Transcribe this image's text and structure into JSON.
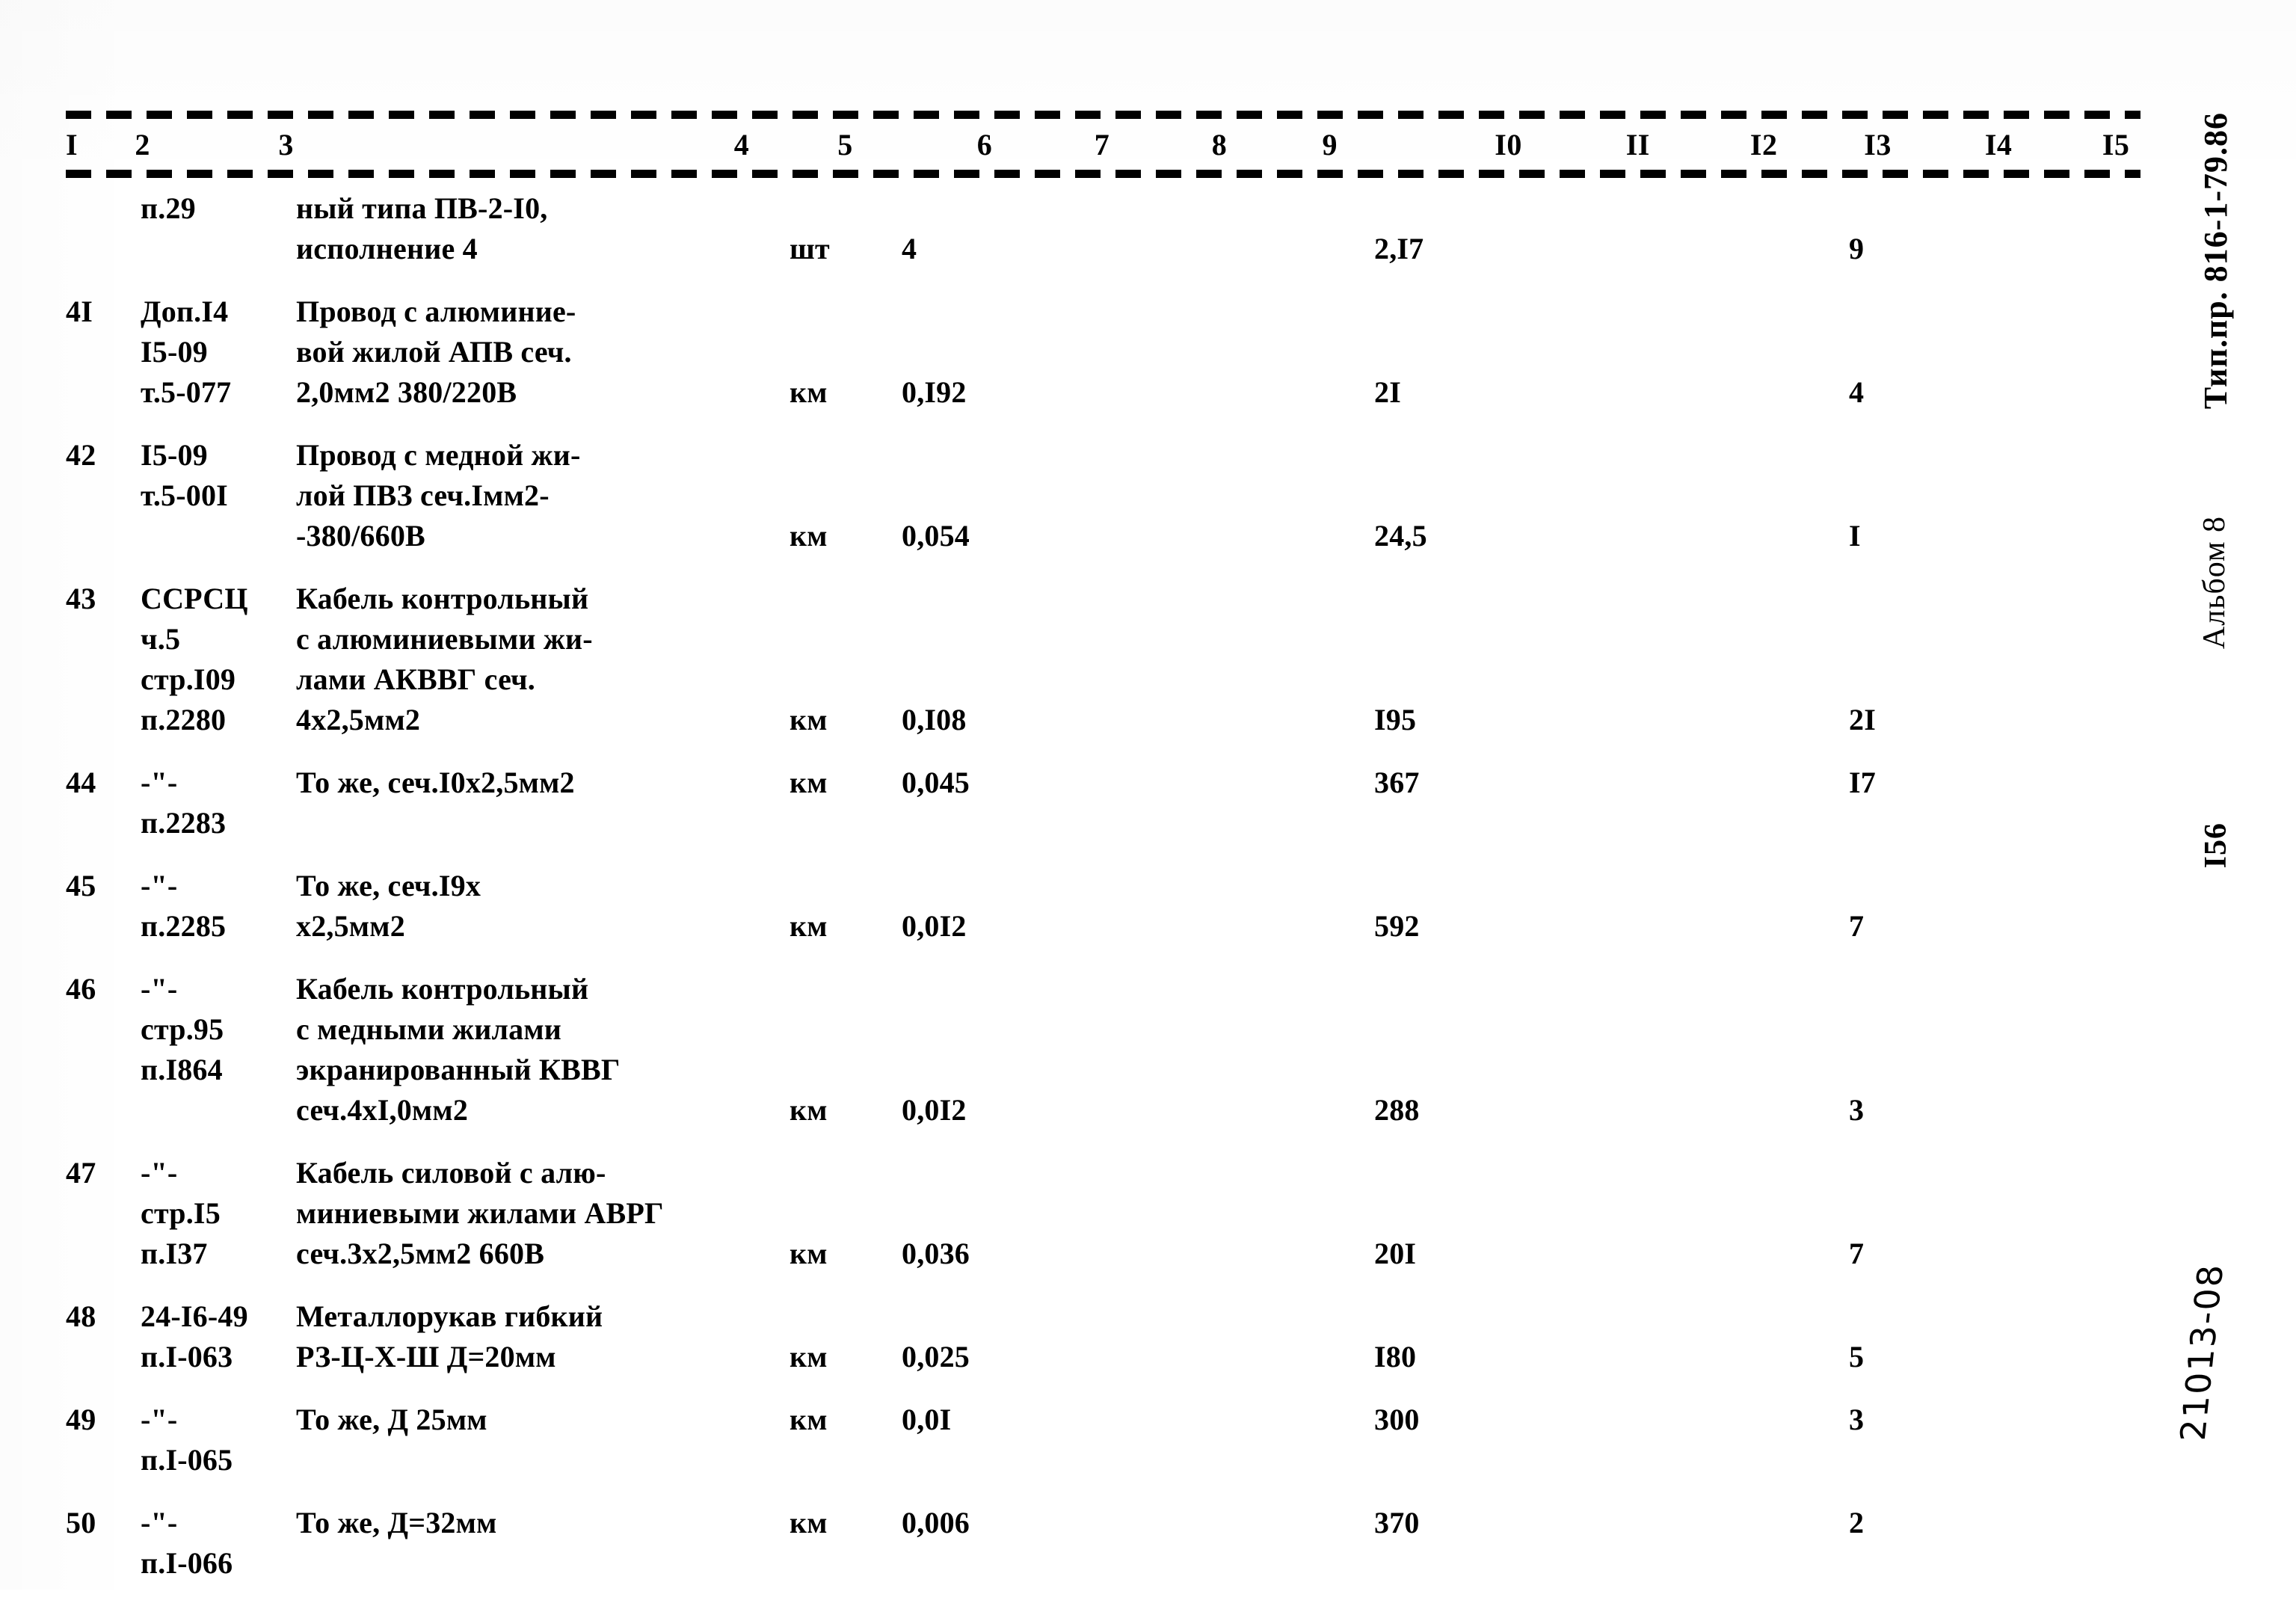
{
  "document": {
    "stamp_title": "Тип.пр. 816-1-79.86",
    "stamp_album": "Альбом 8",
    "stamp_page": "I56",
    "handwritten_mark": "21013-08"
  },
  "table": {
    "column_headers": [
      "I",
      "2",
      "3",
      "4",
      "5",
      "6",
      "7",
      "8",
      "9",
      "I0",
      "II",
      "I2",
      "I3",
      "I4",
      "I5"
    ],
    "rows": [
      {
        "num": "",
        "code": [
          "п.29"
        ],
        "name": [
          "ный типа ПВ-2-I0,",
          "исполнение 4"
        ],
        "unit": "шт",
        "qty": "4",
        "c9": "2,I7",
        "c13": "9",
        "unit_line": 1,
        "qty_line": 1,
        "c9_line": 1,
        "c13_line": 1
      },
      {
        "num": "4I",
        "code": [
          "Доп.I4",
          "I5-09",
          "т.5-077"
        ],
        "name": [
          "Провод с алюминие-",
          "вой жилой АПВ сеч.",
          "2,0мм2 380/220В"
        ],
        "unit": "км",
        "qty": "0,I92",
        "c9": "2I",
        "c13": "4",
        "unit_line": 2,
        "qty_line": 2,
        "c9_line": 2,
        "c13_line": 2
      },
      {
        "num": "42",
        "code": [
          "I5-09",
          "т.5-00I"
        ],
        "name": [
          "Провод с медной жи-",
          "лой ПВЗ сеч.Iмм2-",
          "-380/660В"
        ],
        "unit": "км",
        "qty": "0,054",
        "c9": "24,5",
        "c13": "I",
        "unit_line": 2,
        "qty_line": 2,
        "c9_line": 2,
        "c13_line": 2
      },
      {
        "num": "43",
        "code": [
          "ССРСЦ",
          "ч.5",
          "стр.I09",
          "п.2280"
        ],
        "name": [
          "Кабель контрольный",
          "с алюминиевыми жи-",
          "лами АКВВГ сеч.",
          "4х2,5мм2"
        ],
        "unit": "км",
        "qty": "0,I08",
        "c9": "I95",
        "c13": "2I",
        "unit_line": 3,
        "qty_line": 3,
        "c9_line": 3,
        "c13_line": 3
      },
      {
        "num": "44",
        "code": [
          "-\"-",
          "п.2283"
        ],
        "name": [
          "То же, сеч.I0х2,5мм2"
        ],
        "unit": "км",
        "qty": "0,045",
        "c9": "367",
        "c13": "I7",
        "unit_line": 0,
        "qty_line": 0,
        "c9_line": 0,
        "c13_line": 0
      },
      {
        "num": "45",
        "code": [
          "-\"-",
          "п.2285"
        ],
        "name": [
          "То же, сеч.I9х",
          "х2,5мм2"
        ],
        "unit": "км",
        "qty": "0,0I2",
        "c9": "592",
        "c13": "7",
        "unit_line": 1,
        "qty_line": 1,
        "c9_line": 1,
        "c13_line": 1
      },
      {
        "num": "46",
        "code": [
          "-\"-",
          "стр.95",
          "п.I864"
        ],
        "name": [
          "Кабель контрольный",
          "с медными жилами",
          "экранированный КВВГ",
          "сеч.4хI,0мм2"
        ],
        "unit": "км",
        "qty": "0,0I2",
        "c9": "288",
        "c13": "3",
        "unit_line": 3,
        "qty_line": 3,
        "c9_line": 3,
        "c13_line": 3
      },
      {
        "num": "47",
        "code": [
          "-\"-",
          "стр.I5",
          "п.I37"
        ],
        "name": [
          "Кабель силовой с алю-",
          "миниевыми жилами АВРГ",
          "сеч.3х2,5мм2 660В"
        ],
        "unit": "км",
        "qty": "0,036",
        "c9": "20I",
        "c13": "7",
        "unit_line": 2,
        "qty_line": 2,
        "c9_line": 2,
        "c13_line": 2
      },
      {
        "num": "48",
        "code": [
          "24-I6-49",
          "п.I-063"
        ],
        "name": [
          "Металлорукав гибкий",
          "РЗ-Ц-Х-Ш Д=20мм"
        ],
        "unit": "км",
        "qty": "0,025",
        "c9": "I80",
        "c13": "5",
        "unit_line": 1,
        "qty_line": 1,
        "c9_line": 1,
        "c13_line": 1
      },
      {
        "num": "49",
        "code": [
          "-\"-",
          "п.I-065"
        ],
        "name": [
          "То же, Д 25мм"
        ],
        "unit": "км",
        "qty": "0,0I",
        "c9": "300",
        "c13": "3",
        "unit_line": 0,
        "qty_line": 0,
        "c9_line": 0,
        "c13_line": 0
      },
      {
        "num": "50",
        "code": [
          "-\"-",
          "п.I-066"
        ],
        "name": [
          "То же, Д=32мм"
        ],
        "unit": "км",
        "qty": "0,006",
        "c9": "370",
        "c13": "2",
        "unit_line": 0,
        "qty_line": 0,
        "c9_line": 0,
        "c13_line": 0
      }
    ]
  }
}
